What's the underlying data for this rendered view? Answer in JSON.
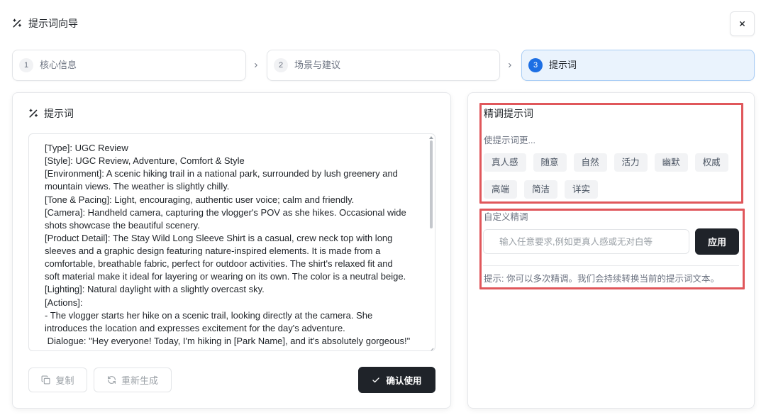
{
  "header": {
    "title": "提示词向导",
    "icon": "magic-wand-icon",
    "close_icon": "close-icon"
  },
  "stepper": {
    "current": 3,
    "separator_icon": "chevron-right-icon",
    "items": [
      {
        "number": "1",
        "label": "核心信息"
      },
      {
        "number": "2",
        "label": "场景与建议"
      },
      {
        "number": "3",
        "label": "提示词"
      }
    ]
  },
  "prompt_panel": {
    "title": "提示词",
    "icon": "magic-wand-icon",
    "text": "[Type]: UGC Review\n[Style]: UGC Review, Adventure, Comfort & Style\n[Environment]: A scenic hiking trail in a national park, surrounded by lush greenery and\nmountain views. The weather is slightly chilly.\n[Tone & Pacing]: Light, encouraging, authentic user voice; calm and friendly.\n[Camera]: Handheld camera, capturing the vlogger's POV as she hikes. Occasional wide\nshots showcase the beautiful scenery.\n[Product Detail]: The Stay Wild Long Sleeve Shirt is a casual, crew neck top with long\nsleeves and a graphic design featuring nature-inspired elements. It is made from a\ncomfortable, breathable fabric, perfect for outdoor activities. The shirt's relaxed fit and\nsoft material make it ideal for layering or wearing on its own. The color is a neutral beige.\n[Lighting]: Natural daylight with a slightly overcast sky.\n[Actions]:\n- The vlogger starts her hike on a scenic trail, looking directly at the camera. She\nintroduces the location and expresses excitement for the day's adventure.\n Dialogue: \"Hey everyone! Today, I'm hiking in [Park Name], and it's absolutely gorgeous!\"",
    "copy_label": "复制",
    "copy_icon": "copy-icon",
    "regenerate_label": "重新生成",
    "regenerate_icon": "refresh-icon",
    "confirm_label": "确认使用",
    "confirm_icon": "check-icon"
  },
  "refine_panel": {
    "title": "精调提示词",
    "subtitle": "使提示词更...",
    "chips": [
      "真人感",
      "随意",
      "自然",
      "活力",
      "幽默",
      "权威",
      "高端",
      "简洁",
      "详实"
    ],
    "custom_label": "自定义精调",
    "input_placeholder": "输入任意要求,例如更真人感或无对白等",
    "input_value": "",
    "apply_label": "应用",
    "hint": "提示: 你可以多次精调。我们会持续转换当前的提示词文本。"
  },
  "colors": {
    "accent": "#1d6fe4",
    "accent_soft": "#eaf3fd",
    "dark_button": "#1f2329",
    "highlight": "#e0575b",
    "chip_bg": "#f2f3f5"
  }
}
